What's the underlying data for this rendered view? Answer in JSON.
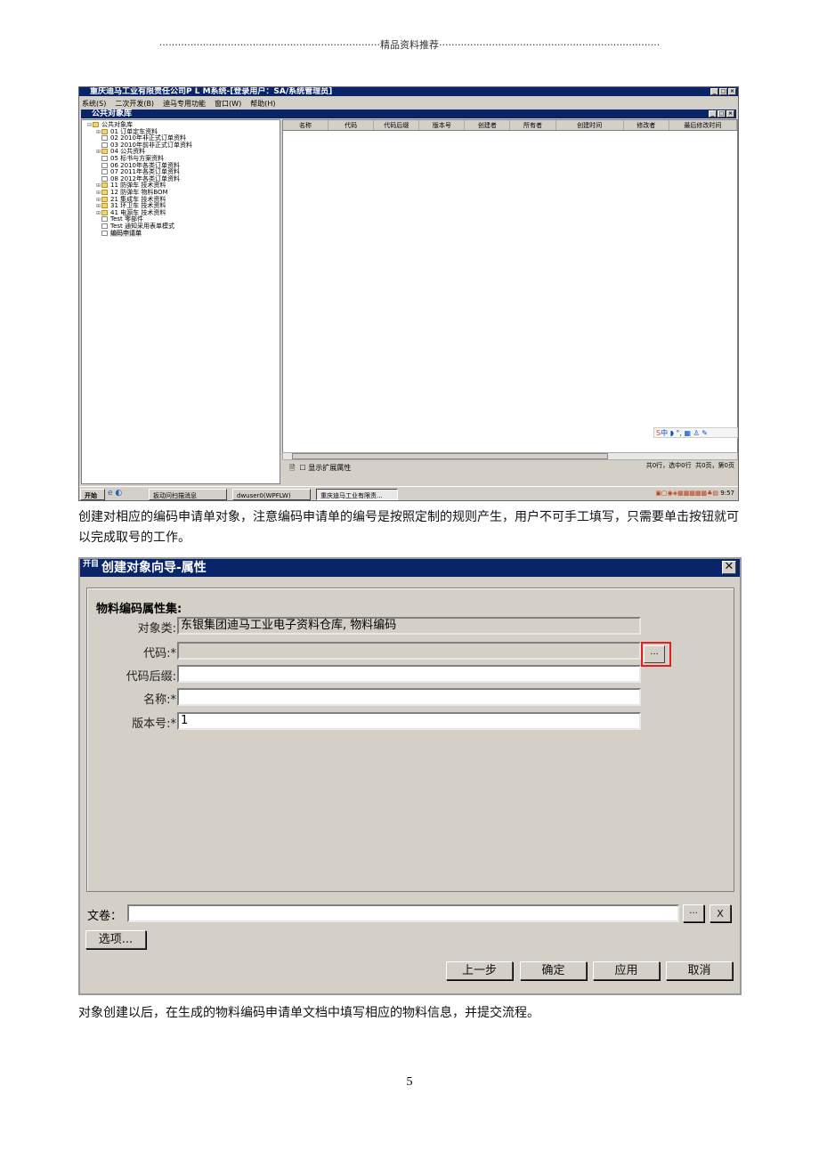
{
  "header": {
    "dots_left": "·······································································",
    "title": "精品资料推荐",
    "dots_right": "·······································································"
  },
  "screenshot1": {
    "title": "重庆迪马工业有限责任公司P L M系统-[登录用户：SA/系统管理员]",
    "menu": [
      "系统(S)",
      "二次开发(B)",
      "迪马专用功能",
      "窗口(W)",
      "帮助(H)"
    ],
    "inner_title": "公共对象库",
    "tree": {
      "root": "公共对象库",
      "items": [
        {
          "label": "01 订单定车资料",
          "type": "folder"
        },
        {
          "label": "02 2010年非正式订单资料",
          "type": "doc"
        },
        {
          "label": "03 2010年前非正式订单资料",
          "type": "doc"
        },
        {
          "label": "04 公共资料",
          "type": "folder"
        },
        {
          "label": "05 标书与方案资料",
          "type": "doc"
        },
        {
          "label": "06 2010年各类订单资料",
          "type": "doc"
        },
        {
          "label": "07 2011年各类订单资料",
          "type": "doc"
        },
        {
          "label": "08 2012年各类订单资料",
          "type": "doc"
        },
        {
          "label": "11 防弹车 技术资料",
          "type": "folder"
        },
        {
          "label": "12 防弹车 物料BOM",
          "type": "folder"
        },
        {
          "label": "21 集成车 技术资料",
          "type": "folder"
        },
        {
          "label": "31 环卫车 技术资料",
          "type": "folder"
        },
        {
          "label": "41 电源车 技术资料",
          "type": "folder"
        },
        {
          "label": "Test 零部件",
          "type": "doc"
        },
        {
          "label": "Test 通知采用表单模式",
          "type": "doc"
        },
        {
          "label": "编码申请单",
          "type": "doc",
          "selected": true
        }
      ]
    },
    "columns": [
      "名称",
      "代码",
      "代码后缀",
      "版本号",
      "创建者",
      "所有者",
      "创建时间",
      "修改者",
      "最后修改时间"
    ],
    "show_ext_label": "显示扩展属性",
    "status_rows": "共0行，选中0行",
    "status_pages": "共0页，第0页",
    "ime_label": "中",
    "taskbar": {
      "start": "开始",
      "tasks": [
        "扳动问扫描消息",
        "dwuser0(WPFLW)",
        "重庆迪马工业有限责..."
      ],
      "clock": "9:57"
    }
  },
  "para1": "创建对相应的编码申请单对象，注意编码申请单的编号是按照定制的规则产生，用户不可手工填写，只需要单击按钮就可以完成取号的工作。",
  "dialog": {
    "icon_text": "开目",
    "title": "创建对象向导-属性",
    "group_title": "物料编码属性集:",
    "fields": [
      {
        "label": "对象类:",
        "value": "东银集团迪马工业电子资料仓库, 物料编码",
        "readonly": true
      },
      {
        "label": "代码:*",
        "value": "",
        "readonly": true
      },
      {
        "label": "代码后缀:",
        "value": ""
      },
      {
        "label": "名称:*",
        "value": ""
      },
      {
        "label": "版本号:*",
        "value": "1"
      }
    ],
    "browse_label": "...",
    "volume_label": "文卷：",
    "volume_value": "",
    "volume_browse": "...",
    "volume_clear": "X",
    "options_label": "选项...",
    "buttons": [
      "上一步",
      "确定",
      "应用",
      "取消"
    ],
    "highlight_color": "#e02020"
  },
  "para2": "对象创建以后，在生成的物料编码申请单文档中填写相应的物料信息，并提交流程。",
  "page_number": "5"
}
